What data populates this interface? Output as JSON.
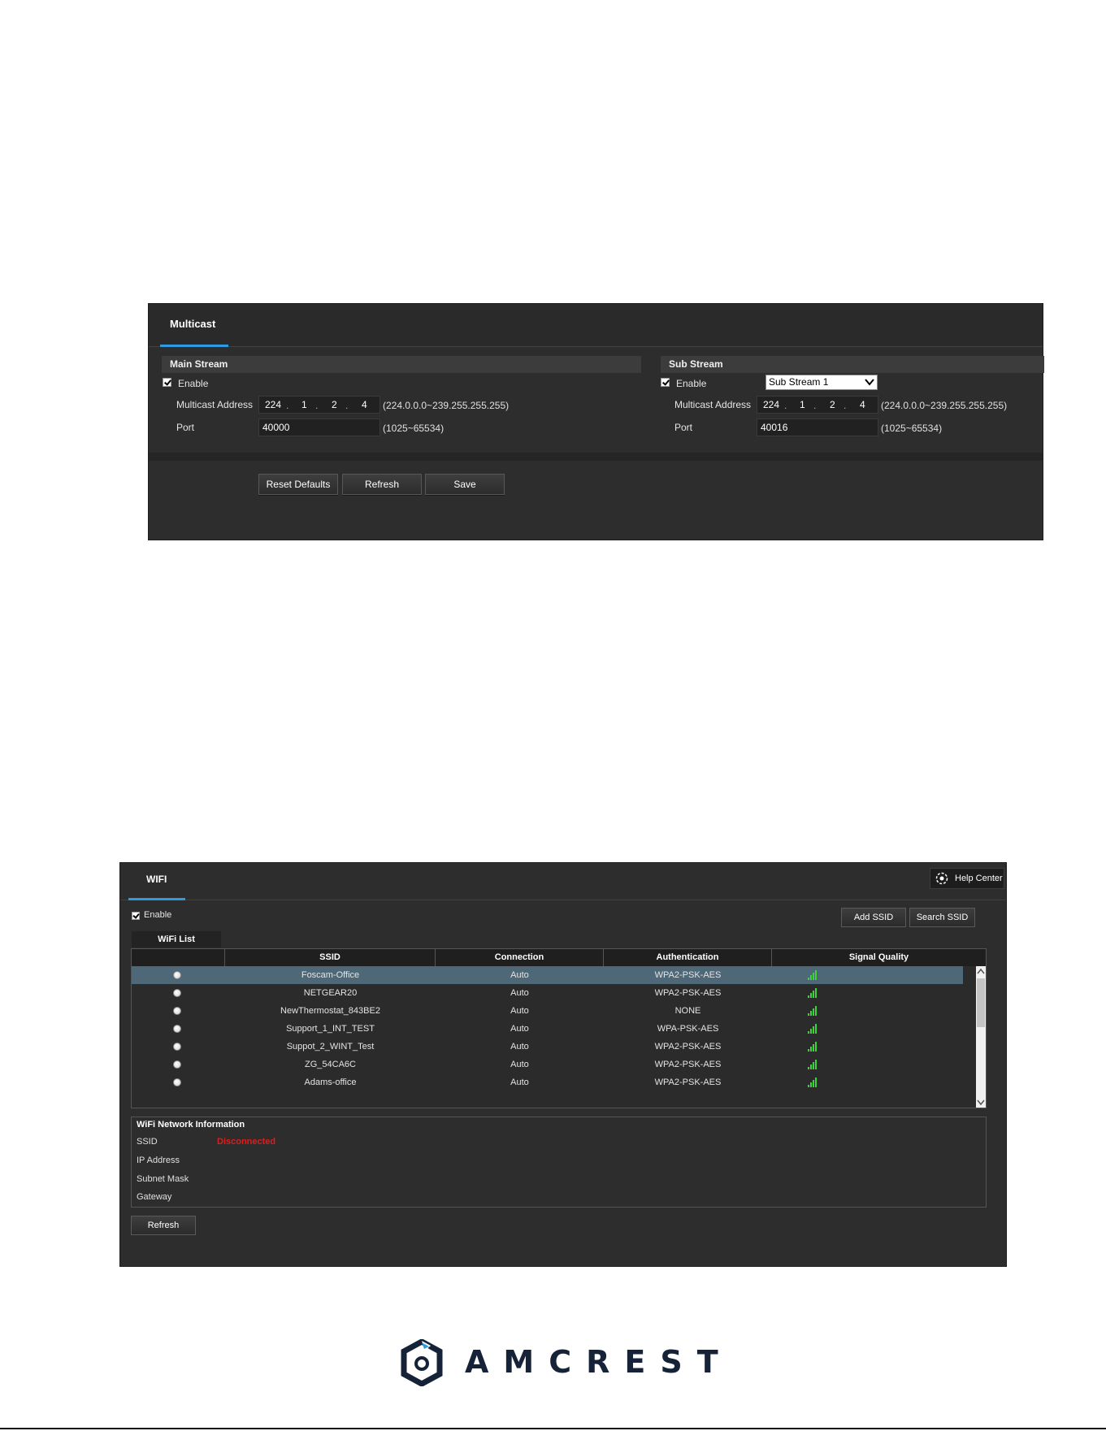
{
  "multicast": {
    "tab_label": "Multicast",
    "main_stream": {
      "title": "Main Stream",
      "enable_label": "Enable",
      "enabled": true,
      "address_label": "Multicast Address",
      "address": [
        "224",
        "1",
        "2",
        "4"
      ],
      "address_hint": "(224.0.0.0~239.255.255.255)",
      "port_label": "Port",
      "port": "40000",
      "port_hint": "(1025~65534)"
    },
    "sub_stream": {
      "title": "Sub Stream",
      "enable_label": "Enable",
      "enabled": true,
      "stream_select": "Sub Stream 1",
      "address_label": "Multicast Address",
      "address": [
        "224",
        "1",
        "2",
        "4"
      ],
      "address_hint": "(224.0.0.0~239.255.255.255)",
      "port_label": "Port",
      "port": "40016",
      "port_hint": "(1025~65534)"
    },
    "buttons": {
      "reset": "Reset Defaults",
      "refresh": "Refresh",
      "save": "Save"
    }
  },
  "wifi": {
    "tab_label": "WIFI",
    "help_center": "Help Center",
    "enable_label": "Enable",
    "enabled": true,
    "add_ssid": "Add SSID",
    "search_ssid": "Search SSID",
    "list_tab": "WiFi List",
    "columns": [
      "",
      "SSID",
      "Connection",
      "Authentication",
      "Signal Quality"
    ],
    "rows": [
      {
        "ssid": "Foscam-Office",
        "connection": "Auto",
        "auth": "WPA2-PSK-AES",
        "signal_bars": 4,
        "selected": true
      },
      {
        "ssid": "NETGEAR20",
        "connection": "Auto",
        "auth": "WPA2-PSK-AES",
        "signal_bars": 4,
        "selected": false
      },
      {
        "ssid": "NewThermostat_843BE2",
        "connection": "Auto",
        "auth": "NONE",
        "signal_bars": 4,
        "selected": false
      },
      {
        "ssid": "Support_1_INT_TEST",
        "connection": "Auto",
        "auth": "WPA-PSK-AES",
        "signal_bars": 4,
        "selected": false
      },
      {
        "ssid": "Suppot_2_WINT_Test",
        "connection": "Auto",
        "auth": "WPA2-PSK-AES",
        "signal_bars": 4,
        "selected": false
      },
      {
        "ssid": "ZG_54CA6C",
        "connection": "Auto",
        "auth": "WPA2-PSK-AES",
        "signal_bars": 4,
        "selected": false
      },
      {
        "ssid": "Adams-office",
        "connection": "Auto",
        "auth": "WPA2-PSK-AES",
        "signal_bars": 4,
        "selected": false
      }
    ],
    "info": {
      "title": "WiFi Network Information",
      "ssid_label": "SSID",
      "ssid_status": "Disconnected",
      "ip_label": "IP Address",
      "mask_label": "Subnet Mask",
      "gateway_label": "Gateway"
    },
    "refresh": "Refresh"
  },
  "logo": {
    "text": "AMCREST",
    "color": "#152238"
  },
  "colors": {
    "accent": "#2b9be3",
    "signal": "#3bd43b",
    "status_error": "#e21b1b",
    "selected_row": "#4f6878"
  }
}
